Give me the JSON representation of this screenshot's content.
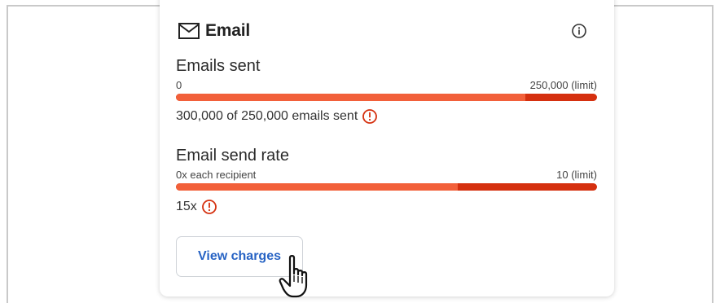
{
  "card": {
    "title": "Email",
    "icon": "mail-icon",
    "info_icon": "info-icon"
  },
  "metrics": [
    {
      "label": "Emails sent",
      "min_label": "0",
      "max_label": "250,000 (limit)",
      "progress_fraction": 0.83,
      "status_text": "300,000 of 250,000 emails sent",
      "status_icon": "warning-icon"
    },
    {
      "label": "Email send rate",
      "min_label": "0x each recipient",
      "max_label": "10 (limit)",
      "progress_fraction": 0.67,
      "status_text": "15x",
      "status_icon": "warning-icon"
    }
  ],
  "actions": {
    "view_charges_label": "View charges"
  },
  "colors": {
    "bar_light": "#f2603a",
    "bar_dark": "#d5300f",
    "warning": "#d5300f",
    "link": "#2763c4"
  }
}
